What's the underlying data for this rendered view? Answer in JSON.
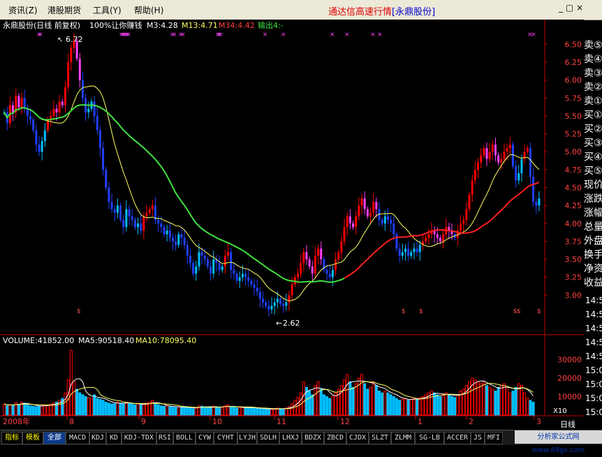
{
  "menu": [
    "资讯(Z)",
    "港股期货",
    "工具(Y)",
    "帮助(H)"
  ],
  "app_title": "通达信高速行情",
  "stock_tag": "[永鼎股份]",
  "window_controls": "_ ▢ ×",
  "info_bar": {
    "name": "永鼎股份(日线 前复权)",
    "strategy": "100%让你赚钱",
    "m3": "M3:4.28",
    "m13": "M13:4.71",
    "m34": "M34:4.42",
    "out4": "输出4:-"
  },
  "annotations": {
    "high": "6.72",
    "low": "2.62"
  },
  "volume_bar": {
    "volume": "VOLUME:41852.00",
    "ma5": "MA5:90518.40",
    "ma10": "MA10:78095.40"
  },
  "xaxis": {
    "year_label": "2008年",
    "month_labels": [
      "8",
      "9",
      "10",
      "11",
      "12",
      "1",
      "2",
      "3"
    ]
  },
  "period_label": "日线",
  "vol_unit": "X10",
  "right_panel": [
    "卖⑤",
    "卖④",
    "卖③",
    "卖②",
    "卖①",
    "买①",
    "买②",
    "买③",
    "买④",
    "买⑤",
    "现价",
    "涨跌",
    "涨幅",
    "总量",
    "外盘",
    "换手",
    "净资",
    "收益"
  ],
  "right_edge_numbers": [
    "14:5",
    "14:5",
    "14:5",
    "14:5",
    "14:5",
    "15:0",
    "15:0",
    "15:0",
    "15:0"
  ],
  "tabs": [
    "指标",
    "模板",
    "全部",
    "MACD",
    "KDJ",
    "KD",
    "KDJ-TDX",
    "RSI",
    "BOLL",
    "CYW",
    "CYHT",
    "LYJH",
    "SDLH",
    "LHXJ",
    "BDZX",
    "ZBCD",
    "CJDX",
    "SLZT",
    "ZLMM",
    "SG-LB",
    "ACCER",
    "JS",
    "MFI"
  ],
  "ad_text": "分析家公式网 www.88gs.com",
  "colors": {
    "up": "#ff0000",
    "down": "#00c0ff",
    "ma_yellow": "#ffff60",
    "ma_green": "#40e040",
    "ma_red": "#ff2020",
    "magenta": "#ff40ff",
    "blue": "#2040ff"
  },
  "chart_data": {
    "type": "candlestick",
    "price_ylim": [
      2.75,
      6.65
    ],
    "price_ticks": [
      6.5,
      6.25,
      6.0,
      5.75,
      5.5,
      5.25,
      5.0,
      4.75,
      4.5,
      4.25,
      4.0,
      3.75,
      3.5,
      3.25,
      3.0
    ],
    "volume_ylim": [
      0,
      37000
    ],
    "volume_ticks": [
      30000,
      20000,
      10000
    ],
    "close": [
      5.55,
      5.4,
      5.65,
      5.55,
      5.78,
      5.62,
      5.75,
      5.6,
      5.5,
      5.45,
      5.3,
      5.1,
      5.0,
      5.15,
      5.3,
      5.45,
      5.5,
      5.6,
      5.55,
      5.7,
      5.65,
      5.9,
      6.25,
      6.45,
      6.55,
      6.3,
      6.0,
      5.75,
      5.55,
      5.6,
      5.7,
      5.5,
      5.3,
      5.05,
      4.75,
      4.5,
      4.3,
      4.2,
      4.15,
      4.25,
      4.05,
      3.95,
      4.2,
      4.1,
      4.05,
      3.95,
      4.0,
      3.9,
      4.1,
      4.15,
      4.2,
      4.25,
      4.05,
      4.0,
      3.95,
      3.85,
      3.9,
      3.8,
      3.75,
      3.7,
      3.85,
      3.8,
      3.7,
      3.55,
      3.45,
      3.3,
      3.4,
      3.6,
      3.55,
      3.5,
      3.4,
      3.3,
      3.5,
      3.45,
      3.35,
      3.4,
      3.55,
      3.6,
      3.35,
      3.3,
      3.2,
      3.25,
      3.3,
      3.25,
      3.2,
      3.15,
      3.1,
      3.05,
      2.95,
      2.9,
      2.85,
      2.8,
      2.85,
      2.9,
      2.95,
      2.88,
      2.85,
      2.9,
      3.0,
      3.15,
      3.25,
      3.3,
      3.45,
      3.6,
      3.5,
      3.4,
      3.3,
      3.55,
      3.65,
      3.5,
      3.35,
      3.3,
      3.25,
      3.35,
      3.5,
      3.6,
      3.75,
      3.95,
      4.1,
      4.0,
      3.95,
      4.1,
      4.25,
      4.35,
      4.2,
      4.1,
      4.15,
      4.3,
      4.2,
      4.05,
      4.0,
      4.1,
      4.05,
      4.0,
      3.85,
      3.65,
      3.55,
      3.6,
      3.65,
      3.55,
      3.6,
      3.65,
      3.6,
      3.7,
      3.75,
      3.8,
      3.85,
      3.9,
      3.85,
      3.8,
      3.75,
      3.85,
      3.95,
      3.9,
      3.85,
      3.8,
      3.9,
      4.0,
      4.05,
      4.2,
      4.4,
      4.6,
      4.75,
      4.85,
      4.95,
      5.05,
      4.9,
      5.0,
      5.1,
      4.95,
      4.85,
      4.9,
      5.0,
      5.05,
      5.1,
      4.8,
      4.6,
      4.7,
      4.9,
      5.0,
      5.05,
      4.65,
      4.3,
      4.25,
      4.35
    ],
    "volume": [
      6000,
      5000,
      5500,
      5200,
      6800,
      5800,
      7000,
      6500,
      5500,
      5000,
      4800,
      4500,
      5000,
      5200,
      5400,
      5600,
      6000,
      6500,
      7000,
      8000,
      9000,
      12000,
      19000,
      35000,
      18000,
      14000,
      12000,
      11000,
      10000,
      9500,
      9000,
      11000,
      9000,
      8500,
      8000,
      7000,
      6500,
      6000,
      6200,
      7000,
      6500,
      6000,
      7000,
      6500,
      6000,
      5500,
      6000,
      5500,
      6000,
      6500,
      7000,
      8000,
      6000,
      5500,
      5000,
      4800,
      5000,
      4500,
      4300,
      4200,
      4500,
      4300,
      4200,
      4000,
      3800,
      3500,
      4000,
      5000,
      4800,
      4500,
      4200,
      4000,
      4800,
      4500,
      4200,
      4300,
      5000,
      5500,
      4500,
      4200,
      3900,
      4000,
      4200,
      4100,
      4000,
      3900,
      3800,
      3600,
      3500,
      3300,
      3200,
      3000,
      3200,
      3500,
      3800,
      3500,
      3400,
      3800,
      4500,
      6000,
      8000,
      9500,
      12000,
      18000,
      15000,
      13000,
      11000,
      16000,
      18000,
      14000,
      11000,
      10000,
      9000,
      10000,
      12000,
      14000,
      16000,
      19000,
      22000,
      18000,
      15000,
      17000,
      20000,
      22000,
      17000,
      14000,
      15000,
      18000,
      16000,
      13000,
      12000,
      13000,
      12000,
      11000,
      10000,
      9000,
      8000,
      8500,
      9000,
      8000,
      8500,
      9000,
      8500,
      9500,
      10000,
      11000,
      12000,
      13000,
      12000,
      11000,
      10000,
      11000,
      12000,
      11000,
      10000,
      9500,
      11000,
      13000,
      14000,
      16000,
      18000,
      20000,
      19000,
      18000,
      17000,
      18000,
      16000,
      15000,
      14000,
      13000,
      15000,
      16000,
      17000,
      14000,
      12000,
      13000,
      15000,
      17000,
      16000,
      12000,
      9000,
      8000,
      7000
    ],
    "ma_labels": [
      "M3",
      "M13",
      "M34"
    ]
  }
}
